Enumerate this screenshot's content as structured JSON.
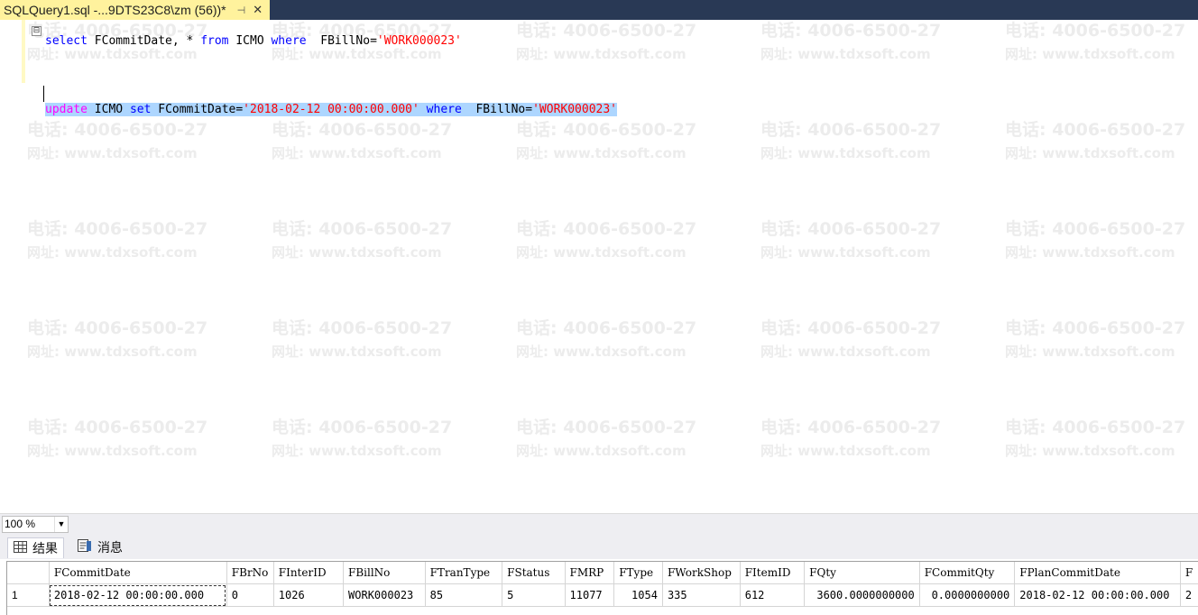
{
  "window": {
    "tab_title": "SQLQuery1.sql -...9DTS23C8\\zm (56))*",
    "pin_glyph": "⊣",
    "close_glyph": "✕"
  },
  "editor": {
    "line1": {
      "fold": "⊟",
      "kw_select": "select",
      "t1": " FCommitDate, * ",
      "kw_from": "from",
      "t2": " ICMO ",
      "kw_where": "where",
      "t3": "  FBillNo=",
      "s1": "'WORK000023'"
    },
    "line2": {
      "kw_update": "update",
      "t1": " ICMO ",
      "kw_set": "set",
      "t2": " FCommitDate=",
      "s1": "'2018-02-12 00:00:00.000'",
      "t3": " ",
      "kw_where": "where",
      "t4": "  FBillNo=",
      "s2": "'WORK000023'"
    }
  },
  "watermark": {
    "phone": "电话: 4006-6500-27",
    "site": "网址: www.tdxsoft.com"
  },
  "zoom": {
    "value": "100 %",
    "dropdown_glyph": "▼"
  },
  "results": {
    "tabs": [
      {
        "label": "结果",
        "icon": "grid-icon"
      },
      {
        "label": "消息",
        "icon": "message-icon"
      }
    ],
    "columns": [
      "",
      "FCommitDate",
      "FBrNo",
      "FInterID",
      "FBillNo",
      "FTranType",
      "FStatus",
      "FMRP",
      "FType",
      "FWorkShop",
      "FItemID",
      "FQty",
      "FCommitQty",
      "FPlanCommitDate",
      "F"
    ],
    "rows": [
      [
        "1",
        "2018-02-12 00:00:00.000",
        "0",
        "1026",
        "WORK000023",
        "85",
        "5",
        "11077",
        "1054",
        "335",
        "612",
        "3600.0000000000",
        "0.0000000000",
        "2018-02-12 00:00:00.000",
        "2"
      ]
    ]
  }
}
